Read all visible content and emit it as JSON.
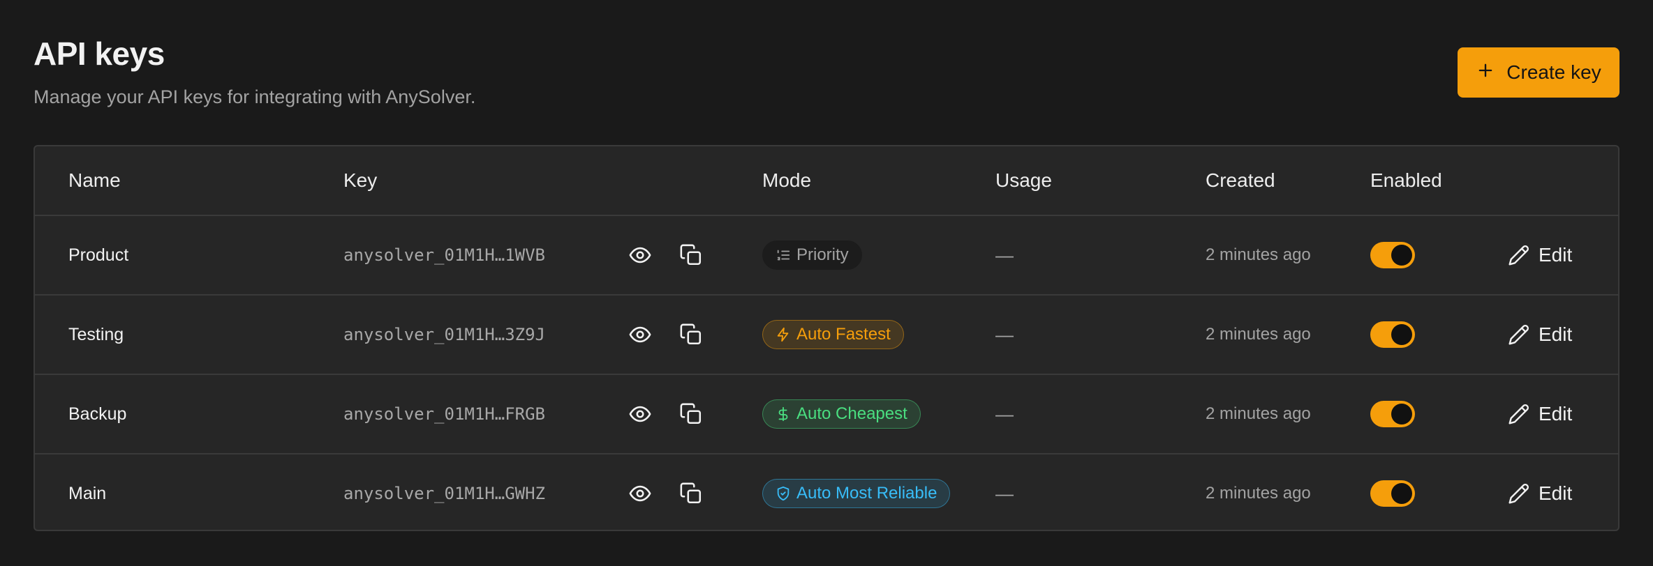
{
  "header": {
    "title": "API keys",
    "subtitle": "Manage your API keys for integrating with AnySolver.",
    "create_label": "Create key"
  },
  "table": {
    "columns": {
      "name": "Name",
      "key": "Key",
      "mode": "Mode",
      "usage": "Usage",
      "created": "Created",
      "enabled": "Enabled"
    },
    "edit_label": "Edit",
    "rows": [
      {
        "name": "Product",
        "key": "anysolver_01M1H…1WVB",
        "mode": "Priority",
        "mode_icon": "list-icon",
        "mode_color": "#a3a3a3",
        "usage": "—",
        "created": "2 minutes ago",
        "enabled": true
      },
      {
        "name": "Testing",
        "key": "anysolver_01M1H…3Z9J",
        "mode": "Auto Fastest",
        "mode_icon": "lightning-icon",
        "mode_color": "#f59e0b",
        "usage": "—",
        "created": "2 minutes ago",
        "enabled": true
      },
      {
        "name": "Backup",
        "key": "anysolver_01M1H…FRGB",
        "mode": "Auto Cheapest",
        "mode_icon": "dollar-icon",
        "mode_color": "#4ade80",
        "usage": "—",
        "created": "2 minutes ago",
        "enabled": true
      },
      {
        "name": "Main",
        "key": "anysolver_01M1H…GWHZ",
        "mode": "Auto Most Reliable",
        "mode_icon": "shield-check-icon",
        "mode_color": "#38bdf8",
        "usage": "—",
        "created": "2 minutes ago",
        "enabled": true
      }
    ]
  },
  "colors": {
    "accent": "#f59e0b",
    "background": "#1a1a1a",
    "card": "#262626"
  }
}
